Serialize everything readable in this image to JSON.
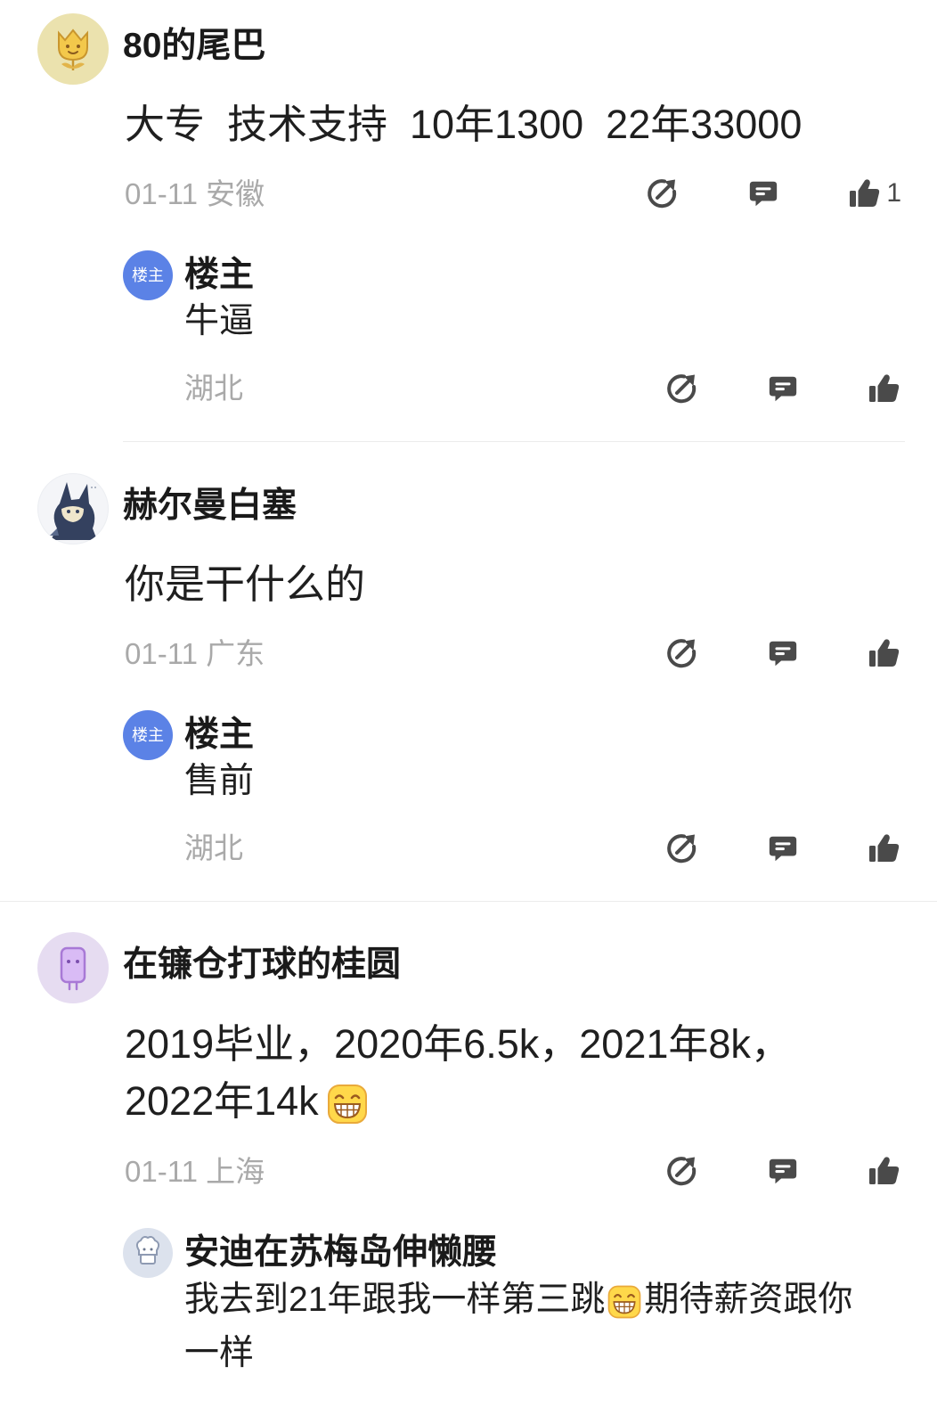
{
  "colors": {
    "text_primary": "#1a1a1a",
    "text_secondary": "#a9a9a9",
    "icon": "#4a4a4a",
    "owner_badge": "#5b82e6",
    "divider": "#ececec",
    "emoji_yellow": "#ffd84a"
  },
  "action_icons": [
    "share-icon",
    "comment-icon",
    "like-icon"
  ],
  "comments": [
    {
      "username": "80的尾巴",
      "avatar_icon": "tulip-avatar-icon",
      "content": {
        "lines": [
          "大专  技术支持  10年1300  22年33000"
        ]
      },
      "date": "01-11",
      "location": "安徽",
      "like_count": "1",
      "replies": [
        {
          "avatar_badge": "楼主",
          "username": "楼主",
          "text": "牛逼",
          "location": "湖北"
        }
      ]
    },
    {
      "username": "赫尔曼白塞",
      "avatar_icon": "cartoon-creature-avatar-icon",
      "content": {
        "lines": [
          "你是干什么的"
        ]
      },
      "date": "01-11",
      "location": "广东",
      "replies": [
        {
          "avatar_badge": "楼主",
          "username": "楼主",
          "text": "售前",
          "location": "湖北"
        }
      ]
    },
    {
      "username": "在镰仓打球的桂圆",
      "avatar_icon": "purple-robot-avatar-icon",
      "content": {
        "lines": [
          "2019毕业，2020年6.5k，2021年8k，",
          "2022年14k"
        ],
        "trailing_emoji": "grinning-emoji-icon"
      },
      "date": "01-11",
      "location": "上海",
      "replies": [
        {
          "avatar_icon": "chef-avatar-icon",
          "username": "安迪在苏梅岛伸懒腰",
          "text": {
            "line1_before_emoji": "我去到21年跟我一样第三跳",
            "emoji": "grinning-emoji-icon",
            "line1_after_emoji": "期待薪资跟你",
            "line2": "一样"
          }
        }
      ]
    }
  ]
}
